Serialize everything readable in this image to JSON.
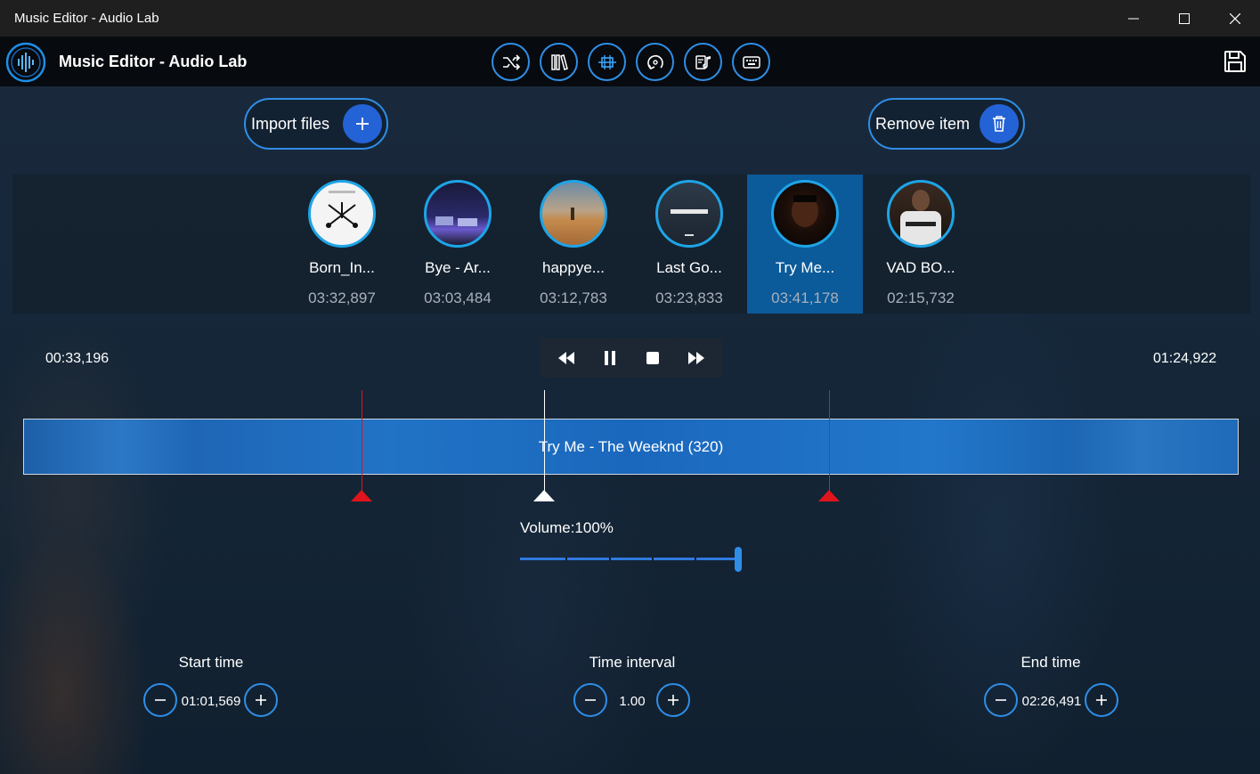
{
  "window": {
    "title": "Music Editor - Audio Lab"
  },
  "app": {
    "title": "Music Editor - Audio Lab",
    "toolbar_icons": [
      "shuffle-icon",
      "library-icon",
      "trim-icon",
      "rotate-icon",
      "music-note-icon",
      "keyboard-icon"
    ],
    "save_icon": "save-icon"
  },
  "actions": {
    "import_label": "Import files",
    "remove_label": "Remove item"
  },
  "tracks": [
    {
      "name": "Born_In...",
      "duration": "03:32,897",
      "selected": false
    },
    {
      "name": "Bye - Ar...",
      "duration": "03:03,484",
      "selected": false
    },
    {
      "name": "happye...",
      "duration": "03:12,783",
      "selected": false
    },
    {
      "name": "Last Go...",
      "duration": "03:23,833",
      "selected": false
    },
    {
      "name": "Try Me...",
      "duration": "03:41,178",
      "selected": true
    },
    {
      "name": "VAD BO...",
      "duration": "02:15,732",
      "selected": false
    }
  ],
  "playback": {
    "current_time": "00:33,196",
    "remaining_time": "01:24,922",
    "track_label": "Try Me - The Weeknd (320)"
  },
  "volume": {
    "label": "Volume:100%",
    "level_percent": 100
  },
  "steppers": {
    "start": {
      "title": "Start time",
      "value": "01:01,569"
    },
    "interval": {
      "title": "Time interval",
      "value": "1.00"
    },
    "end": {
      "title": "End time",
      "value": "02:26,491"
    }
  },
  "colors": {
    "accent": "#2f8ee6",
    "selected": "#0b5a9a",
    "marker": "#e0141c"
  }
}
